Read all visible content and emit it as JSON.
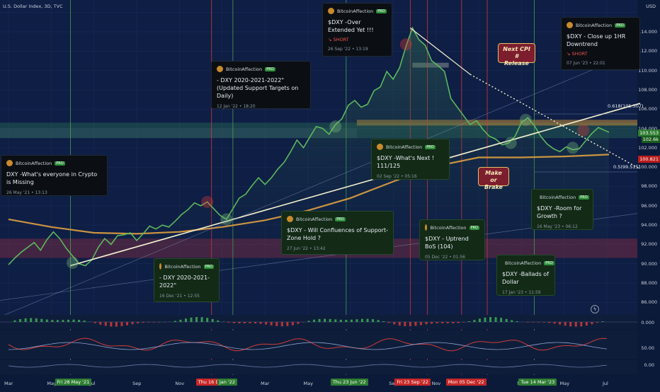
{
  "header": {
    "symbol_title": "U.S. Dollar Index, 3D, TVC",
    "currency": "USD"
  },
  "chart_data": {
    "type": "line",
    "title": "U.S. Dollar Index, 3D, TVC",
    "ylim": [
      85,
      117
    ],
    "yticks": [
      "114.000",
      "112.000",
      "110.000",
      "108.000",
      "106.000",
      "104.000",
      "102.000",
      "100.000",
      "98.000",
      "96.000",
      "94.000",
      "92.000",
      "90.000",
      "88.000",
      "86.000"
    ],
    "price_tags": [
      {
        "label": "103.553",
        "value": 103.55,
        "color": "#2e7d32"
      },
      {
        "label": "102.6k",
        "value": 102.9,
        "color": "#1b5e20"
      },
      {
        "label": "100.821",
        "value": 100.82,
        "color": "#b71c1c"
      }
    ],
    "fib_labels": [
      {
        "text": "0.618(105.507)",
        "value": 105.5
      },
      {
        "text": "0.5(99.515)",
        "value": 99.5
      }
    ],
    "x_tick_labels": [
      {
        "text": "Mar",
        "t": 0.0
      },
      {
        "text": "May",
        "t": 2.0
      },
      {
        "text": "Jul",
        "t": 4.0
      },
      {
        "text": "Sep",
        "t": 6.0
      },
      {
        "text": "Nov",
        "t": 8.0
      },
      {
        "text": "Mar",
        "t": 12.0
      },
      {
        "text": "May",
        "t": 14.0
      },
      {
        "text": "Sep",
        "t": 18.0
      },
      {
        "text": "Nov",
        "t": 20.0
      },
      {
        "text": "Mar",
        "t": 24.0
      },
      {
        "text": "May",
        "t": 26.0
      },
      {
        "text": "Jul",
        "t": 28.0
      }
    ],
    "x_badges": [
      {
        "text": "Fri 28 May '21",
        "t": 2.9,
        "bg": "#2e7d32",
        "fg": "#ffffff"
      },
      {
        "text": "Thu 16 Dec '21",
        "t": 9.5,
        "bg": "#c62828",
        "fg": "#ffffff"
      },
      {
        "text": "Jan '22",
        "t": 10.5,
        "bg": "#2e7d32",
        "fg": "#ffffff"
      },
      {
        "text": "Thu 23 Jun '22",
        "t": 15.8,
        "bg": "#2e7d32",
        "fg": "#ffffff"
      },
      {
        "text": "Fri 23 Sep '22",
        "t": 18.8,
        "bg": "#c62828",
        "fg": "#ffffff"
      },
      {
        "text": "Mon 05 Dec '22",
        "t": 21.2,
        "bg": "#c62828",
        "fg": "#ffffff"
      },
      {
        "text": "Tue 14 Mar '23",
        "t": 24.6,
        "bg": "#2e7d32",
        "fg": "#ffffff"
      }
    ],
    "series": [
      {
        "color": "#5cb85c",
        "points": [
          [
            0,
            89.9
          ],
          [
            0.3,
            90.6
          ],
          [
            0.6,
            91.2
          ],
          [
            0.9,
            91.7
          ],
          [
            1.2,
            92.2
          ],
          [
            1.5,
            91.4
          ],
          [
            1.8,
            92.5
          ],
          [
            2.1,
            93.3
          ],
          [
            2.4,
            92.6
          ],
          [
            2.7,
            91.6
          ],
          [
            3.0,
            90.8
          ],
          [
            3.3,
            90.0
          ],
          [
            3.6,
            89.8
          ],
          [
            3.9,
            90.4
          ],
          [
            4.2,
            91.7
          ],
          [
            4.5,
            92.6
          ],
          [
            4.8,
            92.0
          ],
          [
            5.1,
            92.9
          ],
          [
            5.4,
            93.0
          ],
          [
            5.7,
            93.2
          ],
          [
            6.0,
            92.4
          ],
          [
            6.3,
            93.1
          ],
          [
            6.6,
            93.9
          ],
          [
            6.9,
            93.6
          ],
          [
            7.2,
            94.0
          ],
          [
            7.5,
            93.8
          ],
          [
            7.8,
            94.4
          ],
          [
            8.1,
            95.1
          ],
          [
            8.4,
            95.6
          ],
          [
            8.7,
            96.3
          ],
          [
            9.0,
            96.0
          ],
          [
            9.3,
            96.4
          ],
          [
            9.6,
            95.7
          ],
          [
            9.9,
            95.0
          ],
          [
            10.2,
            94.6
          ],
          [
            10.5,
            95.7
          ],
          [
            10.8,
            96.8
          ],
          [
            11.1,
            97.2
          ],
          [
            11.4,
            98.1
          ],
          [
            11.7,
            98.9
          ],
          [
            12.0,
            98.2
          ],
          [
            12.3,
            98.9
          ],
          [
            12.6,
            99.8
          ],
          [
            12.9,
            100.5
          ],
          [
            13.2,
            101.6
          ],
          [
            13.5,
            102.8
          ],
          [
            13.8,
            102.0
          ],
          [
            14.1,
            103.1
          ],
          [
            14.4,
            104.2
          ],
          [
            14.7,
            104.0
          ],
          [
            15.0,
            103.4
          ],
          [
            15.3,
            104.4
          ],
          [
            15.6,
            105.0
          ],
          [
            15.9,
            106.4
          ],
          [
            16.2,
            106.9
          ],
          [
            16.5,
            106.2
          ],
          [
            16.8,
            106.5
          ],
          [
            17.1,
            107.9
          ],
          [
            17.4,
            108.3
          ],
          [
            17.7,
            109.9
          ],
          [
            18.0,
            109.1
          ],
          [
            18.3,
            110.3
          ],
          [
            18.6,
            112.5
          ],
          [
            18.9,
            114.4
          ],
          [
            19.2,
            113.2
          ],
          [
            19.5,
            112.6
          ],
          [
            19.8,
            111.0
          ],
          [
            20.1,
            110.5
          ],
          [
            20.4,
            109.9
          ],
          [
            20.7,
            107.1
          ],
          [
            21.0,
            106.2
          ],
          [
            21.3,
            105.3
          ],
          [
            21.6,
            104.4
          ],
          [
            21.9,
            104.8
          ],
          [
            22.2,
            103.9
          ],
          [
            22.5,
            103.2
          ],
          [
            22.8,
            102.9
          ],
          [
            23.1,
            102.3
          ],
          [
            23.4,
            102.5
          ],
          [
            23.7,
            103.2
          ],
          [
            24.0,
            104.6
          ],
          [
            24.3,
            105.1
          ],
          [
            24.6,
            104.3
          ],
          [
            24.9,
            103.2
          ],
          [
            25.2,
            102.4
          ],
          [
            25.5,
            101.9
          ],
          [
            25.8,
            101.6
          ],
          [
            26.1,
            102.1
          ],
          [
            26.4,
            101.8
          ],
          [
            26.7,
            101.9
          ],
          [
            27.0,
            102.7
          ],
          [
            27.3,
            103.5
          ],
          [
            27.6,
            104.1
          ],
          [
            27.9,
            103.8
          ],
          [
            28.1,
            103.6
          ]
        ]
      },
      {
        "color": "#e0a040",
        "points": [
          [
            0,
            94.6
          ],
          [
            2,
            93.8
          ],
          [
            4,
            93.2
          ],
          [
            6,
            93.1
          ],
          [
            8,
            93.3
          ],
          [
            10,
            93.8
          ],
          [
            12,
            94.5
          ],
          [
            14,
            95.5
          ],
          [
            16,
            96.8
          ],
          [
            18,
            98.5
          ],
          [
            20,
            100.1
          ],
          [
            22,
            101.0
          ],
          [
            24,
            101.0
          ],
          [
            26,
            101.1
          ],
          [
            28.1,
            101.3
          ]
        ]
      }
    ],
    "annotations": [
      {
        "text": "Next CPI\n# Release"
      },
      {
        "text": "Make or\nBrake"
      }
    ]
  },
  "ideas": [
    {
      "author": "BitcoinAffection",
      "badge": "PRO",
      "title": "DXY       -What's everyone in Crypto is Missing",
      "signal": "",
      "date": "26 May '21 • 13:13"
    },
    {
      "author": "BitcoinAffection",
      "badge": "PRO",
      "title": "- DXY  2020-2021-2022\"",
      "signal": "",
      "date": "16 Dec '21 • 12:55"
    },
    {
      "author": "BitcoinAffection",
      "badge": "PRO",
      "title": "- DXY  2020-2021-2022\" (Updated Support Targets on Daily)",
      "signal": "",
      "date": "12 Jan '22 • 18:20"
    },
    {
      "author": "BitcoinAffection",
      "badge": "PRO",
      "title": "$DXY - Will Confluences of Support-Zone Hold ?",
      "signal": "",
      "date": "27 Jun '22 • 13:42"
    },
    {
      "author": "BitcoinAffection",
      "badge": "PRO",
      "title": "$DXY -What's Next ! 111/125",
      "signal": "",
      "date": "02 Sep '22 • 05:16"
    },
    {
      "author": "BitcoinAffection",
      "badge": "PRO",
      "title": "$DXY -Over Extended Yet !!!",
      "signal": "↘ SHORT",
      "date": "26 Sep '22 • 13:19"
    },
    {
      "author": "BitcoinAffection",
      "badge": "PRO",
      "title": "$DXY - Uptrend BoS (104)",
      "signal": "",
      "date": "05 Dec '22 • 01:56"
    },
    {
      "author": "BitcoinAffection",
      "badge": "PRO",
      "title": "$DXY -Ballads of Dollar",
      "signal": "",
      "date": "17 Jan '23 • 11:59"
    },
    {
      "author": "BitcoinAffection",
      "badge": "PRO",
      "title": "$DXY -Room for Growth ?",
      "signal": "",
      "date": "16 May '23 • 06:12"
    },
    {
      "author": "BitcoinAffection",
      "badge": "PRO",
      "title": "$DXY - Close up 1HR Downtrend",
      "signal": "↘ SHORT",
      "date": "07 Jun '23 • 22:01"
    }
  ],
  "indicators": {
    "rsi_labels": [
      "0.000",
      "50.00",
      "0.00"
    ]
  },
  "colors": {
    "background": "#0c1a3a",
    "price": "#5cb85c",
    "ma": "#e0a040",
    "red": "#c62828",
    "green": "#2e7d32"
  }
}
